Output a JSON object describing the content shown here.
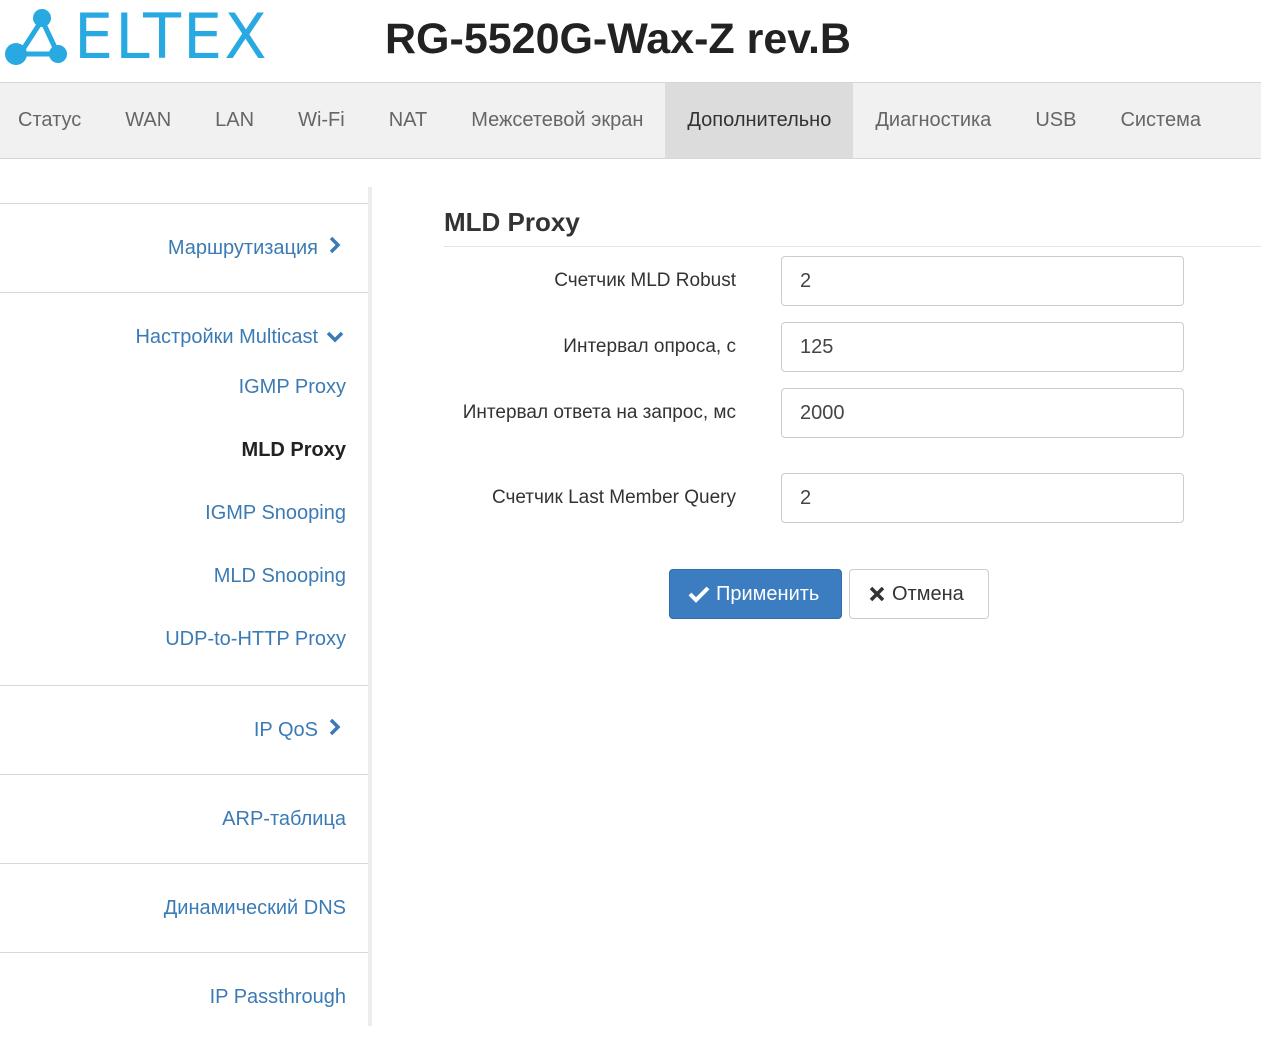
{
  "header": {
    "logo_text": "ELTEX",
    "device_title": "RG-5520G-Wax-Z rev.B"
  },
  "topnav": {
    "tabs": [
      {
        "label": "Статус"
      },
      {
        "label": "WAN"
      },
      {
        "label": "LAN"
      },
      {
        "label": "Wi-Fi"
      },
      {
        "label": "NAT"
      },
      {
        "label": "Межсетевой экран"
      },
      {
        "label": "Дополнительно",
        "active": true
      },
      {
        "label": "Диагностика"
      },
      {
        "label": "USB"
      },
      {
        "label": "Система"
      }
    ]
  },
  "sidebar": {
    "routing": "Маршрутизация",
    "multicast": "Настройки Multicast",
    "multicast_items": [
      "IGMP Proxy",
      "MLD Proxy",
      "IGMP Snooping",
      "MLD Snooping",
      "UDP-to-HTTP Proxy"
    ],
    "qos": "IP QoS",
    "arp": "ARP-таблица",
    "ddns": "Динамический DNS",
    "passthrough": "IP Passthrough"
  },
  "panel": {
    "title": "MLD Proxy",
    "fields": [
      {
        "label": "Счетчик MLD Robust",
        "value": "2"
      },
      {
        "label": "Интервал опроса, с",
        "value": "125"
      },
      {
        "label": "Интервал ответа на запрос, мс",
        "value": "2000"
      },
      {
        "label": "Счетчик Last Member Query",
        "value": "2"
      }
    ],
    "apply_label": "Применить",
    "cancel_label": "Отмена"
  },
  "colors": {
    "brand": "#29a9e1",
    "link": "#3b7bb5",
    "primary_button": "#3b7dc0"
  }
}
